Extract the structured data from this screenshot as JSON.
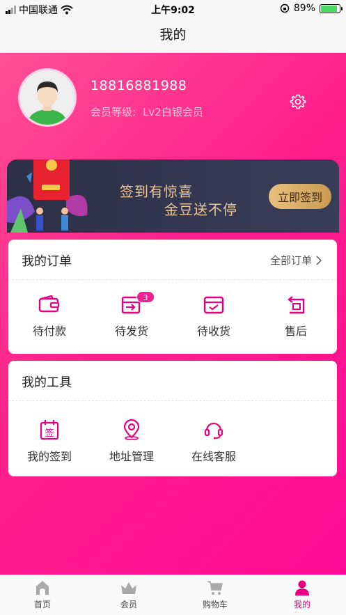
{
  "status_bar": {
    "carrier": "中国联通",
    "time": "上午9:02",
    "battery": "89%",
    "battery_level": 0.89
  },
  "nav": {
    "title": "我的"
  },
  "profile": {
    "phone": "18816881988",
    "member_label": "会员等级:",
    "member_level": "Lv2白银会员"
  },
  "banner": {
    "line1": "签到有惊喜",
    "line2": "金豆送不停",
    "button": "立即签到"
  },
  "orders": {
    "title": "我的订单",
    "all_label": "全部订单",
    "items": [
      {
        "label": "待付款",
        "icon": "wallet-icon"
      },
      {
        "label": "待发货",
        "icon": "shipping-box-icon",
        "badge": "3"
      },
      {
        "label": "待收货",
        "icon": "receive-box-icon"
      },
      {
        "label": "售后",
        "icon": "return-icon"
      }
    ]
  },
  "tools": {
    "title": "我的工具",
    "items": [
      {
        "label": "我的签到",
        "icon": "calendar-sign-icon",
        "glyph": "签"
      },
      {
        "label": "地址管理",
        "icon": "location-icon"
      },
      {
        "label": "在线客服",
        "icon": "headset-icon"
      }
    ]
  },
  "tabbar": {
    "items": [
      {
        "label": "首页",
        "icon": "home-icon"
      },
      {
        "label": "会员",
        "icon": "crown-icon"
      },
      {
        "label": "购物车",
        "icon": "cart-icon"
      },
      {
        "label": "我的",
        "icon": "user-icon",
        "active": true
      }
    ]
  },
  "colors": {
    "accent": "#e4007f",
    "gold": "#e8c79a",
    "banner_bg": "#2c2f45"
  }
}
